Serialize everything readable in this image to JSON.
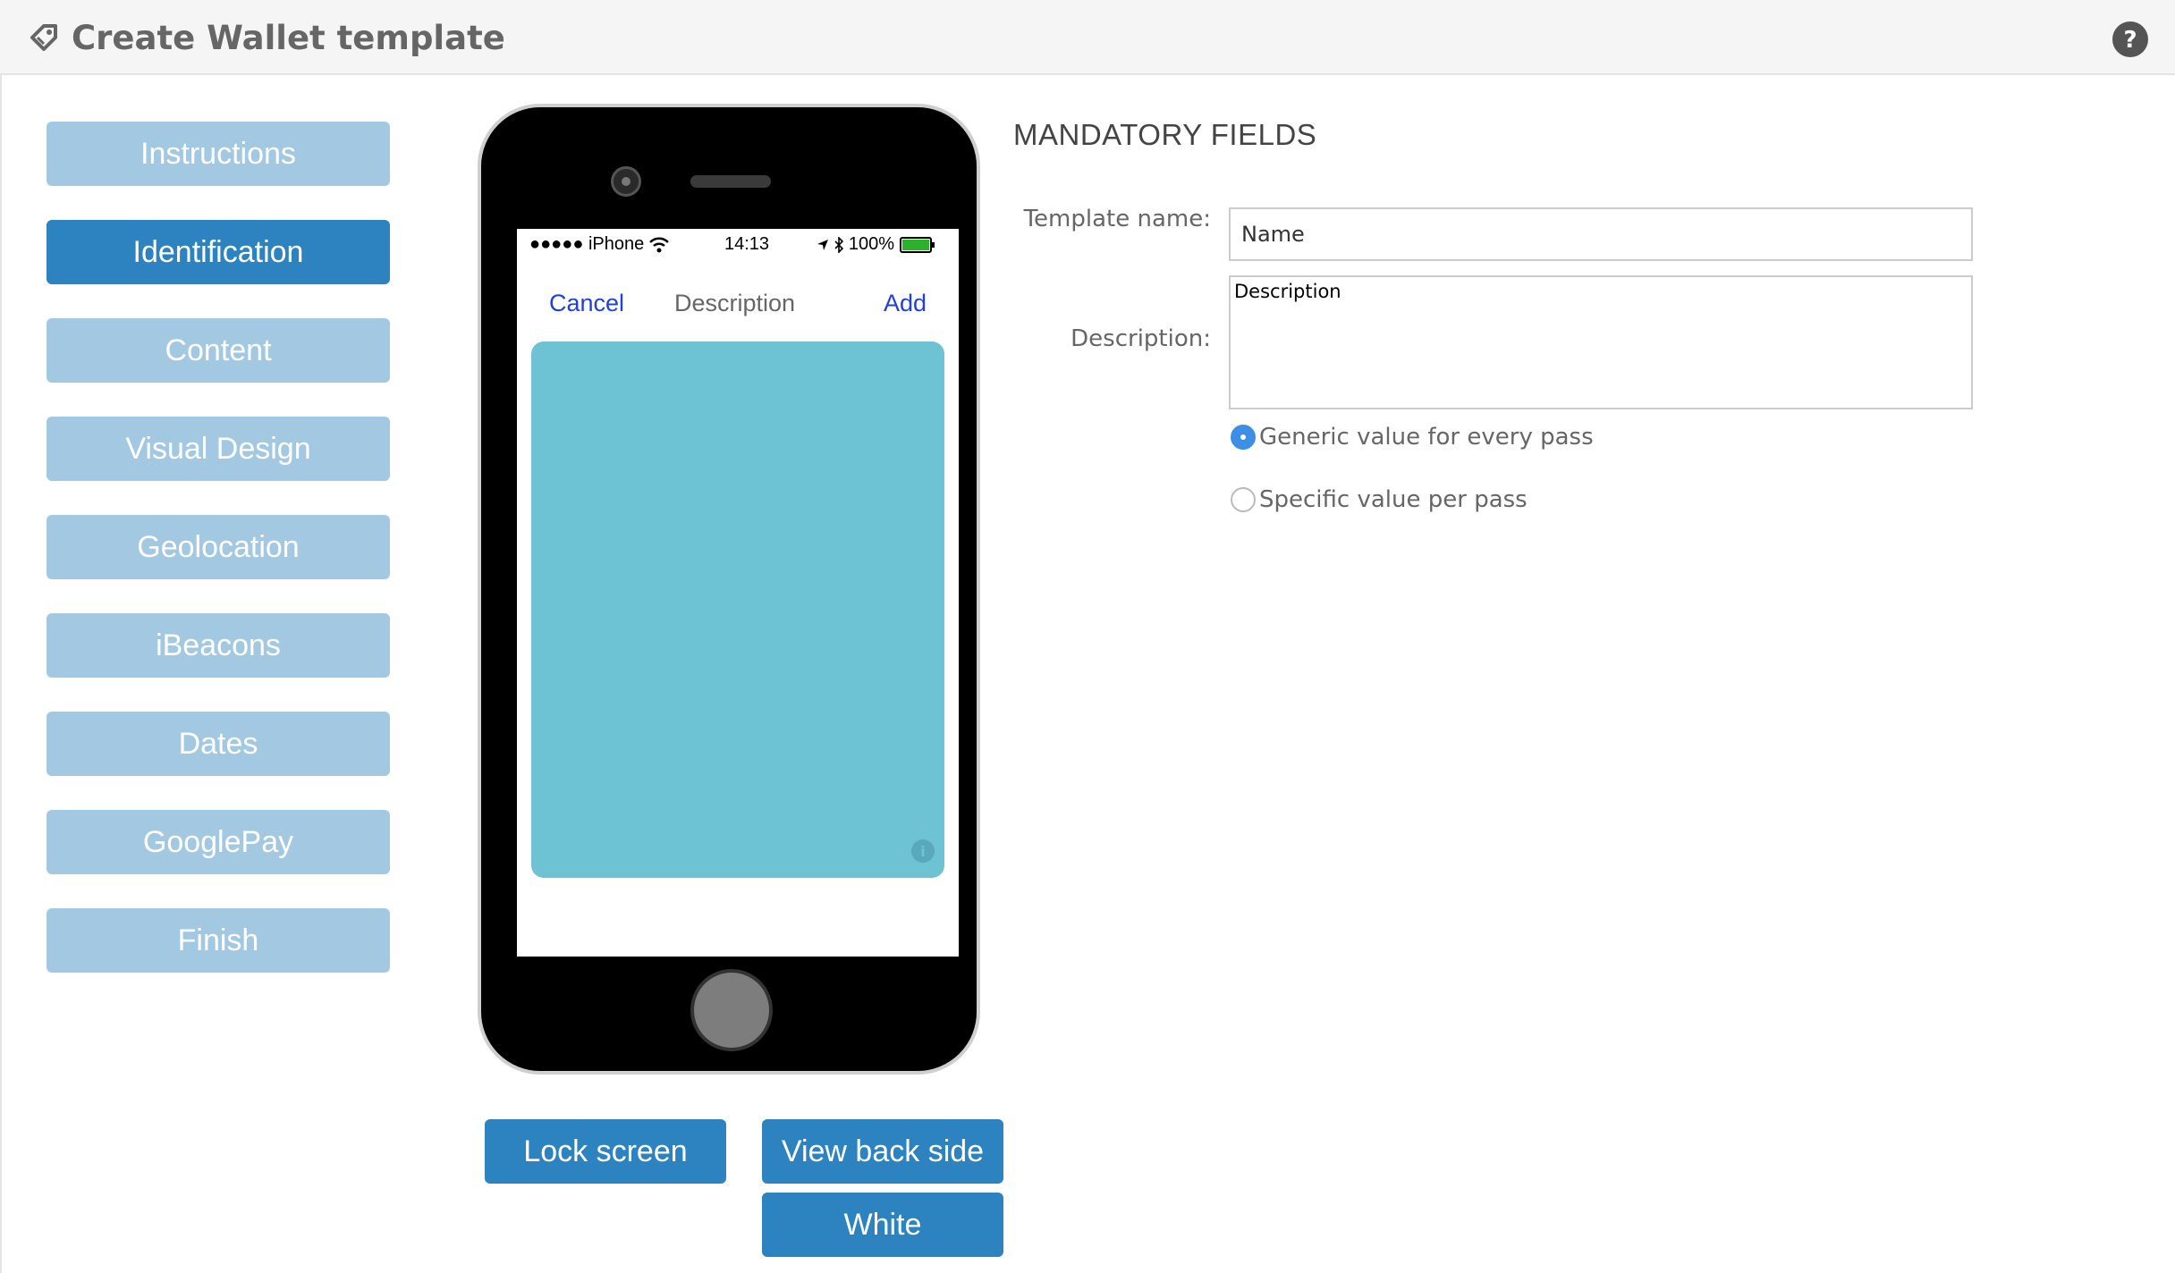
{
  "header": {
    "title": "Create Wallet template",
    "title_icon": "tag-icon",
    "help_icon": "help-icon"
  },
  "sidebar": {
    "items": [
      {
        "label": "Instructions",
        "active": false
      },
      {
        "label": "Identification",
        "active": true
      },
      {
        "label": "Content",
        "active": false
      },
      {
        "label": "Visual Design",
        "active": false
      },
      {
        "label": "Geolocation",
        "active": false
      },
      {
        "label": "iBeacons",
        "active": false
      },
      {
        "label": "Dates",
        "active": false
      },
      {
        "label": "GooglePay",
        "active": false
      },
      {
        "label": "Finish",
        "active": false
      }
    ]
  },
  "phone": {
    "status": {
      "carrier": "●●●●● iPhone",
      "time": "14:13",
      "battery": "100%"
    },
    "nav": {
      "cancel": "Cancel",
      "title": "Description",
      "add": "Add"
    },
    "card_color": "#6dc2d4"
  },
  "actions": {
    "lock_screen": "Lock screen",
    "view_back_side": "View back side",
    "white": "White"
  },
  "form": {
    "section_title": "MANDATORY FIELDS",
    "template_name_label": "Template name:",
    "template_name_value": "Name",
    "description_label": "Description:",
    "description_value": "Description",
    "radio_generic": "Generic value for every pass",
    "radio_specific": "Specific value per pass",
    "selected": "generic"
  },
  "colors": {
    "accent": "#2c83c0",
    "inactive": "#a3c9e2",
    "header_bg": "#f5f5f5"
  }
}
